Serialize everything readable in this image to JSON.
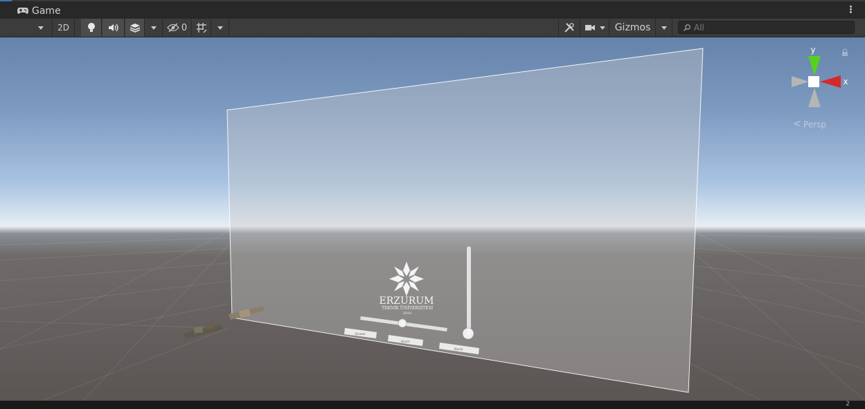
{
  "tab": {
    "title": "Game"
  },
  "toolbar": {
    "mode_2d_label": "2D",
    "hidden_count": "0",
    "gizmos_label": "Gizmos",
    "search_placeholder": "All"
  },
  "gizmo": {
    "y_label": "y",
    "x_label": "x",
    "projection_label": "Persp"
  },
  "canvas": {
    "logo_title": "ERZURUM",
    "logo_subtitle": "TEKNİK ÜNİVERSİTESİ",
    "logo_year": "2010",
    "button_left_label": "Home",
    "button_middle_label": "Start",
    "button_right_label": "Back"
  },
  "status": {
    "text": "2"
  },
  "colors": {
    "accent": "#3a79bb",
    "gizmo_y": "#55d11e",
    "gizmo_x": "#d62a2a"
  },
  "icons": [
    "gamepad-icon",
    "lighting-icon",
    "audio-icon",
    "effects-icon",
    "visibility-icon",
    "grid-icon",
    "tools-icon",
    "camera-icon",
    "search-icon",
    "menu-icon",
    "lock-icon"
  ]
}
